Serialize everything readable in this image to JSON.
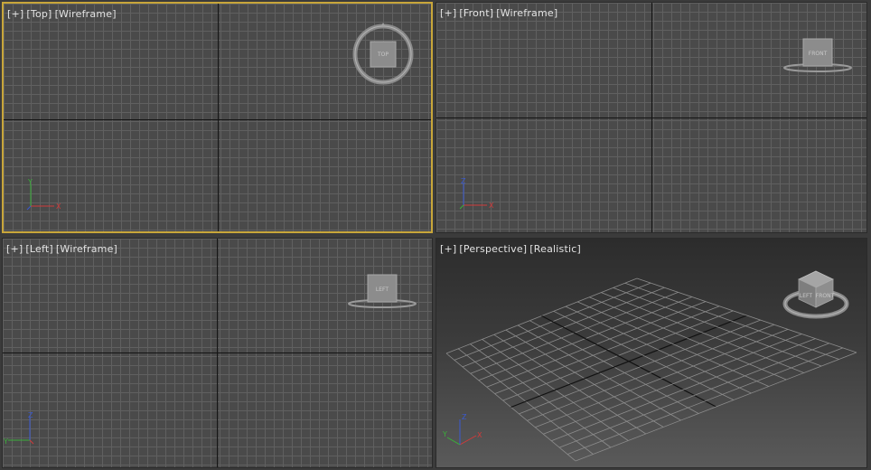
{
  "viewports": {
    "top": {
      "plus": "[+]",
      "view": "[Top]",
      "mode": "[Wireframe]",
      "cube_label": "TOP"
    },
    "front": {
      "plus": "[+]",
      "view": "[Front]",
      "mode": "[Wireframe]",
      "cube_label": "FRONT"
    },
    "left": {
      "plus": "[+]",
      "view": "[Left]",
      "mode": "[Wireframe]",
      "cube_label": "LEFT"
    },
    "persp": {
      "plus": "[+]",
      "view": "[Perspective]",
      "mode": "[Realistic]",
      "cube_label_a": "LEFT",
      "cube_label_b": "FRONT"
    }
  },
  "axes": {
    "x": "X",
    "y": "Y",
    "z": "Z"
  },
  "colors": {
    "active_border": "#c8a63a",
    "axis_x": "#d23a3a",
    "axis_y": "#3ab03a",
    "axis_z": "#3a5ad2"
  }
}
